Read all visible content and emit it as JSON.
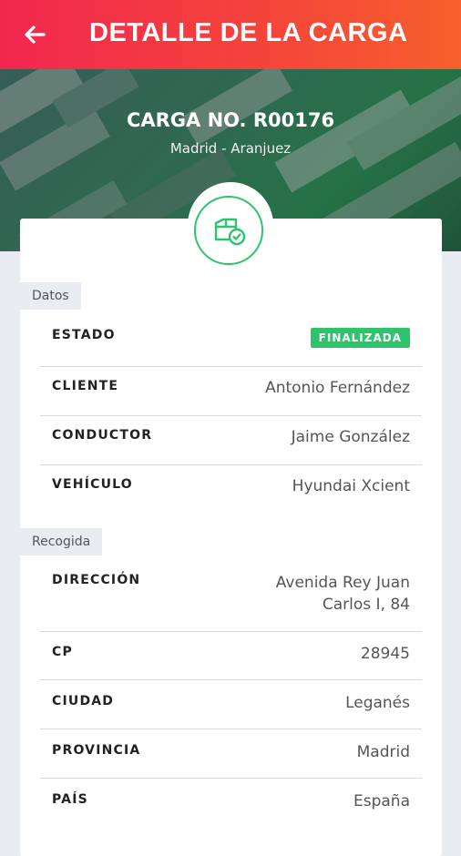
{
  "appbar": {
    "title": "DETALLE DE LA CARGA",
    "back_icon": "arrow-left-icon",
    "gradient": [
      "#f2274f",
      "#f75f2c"
    ]
  },
  "hero": {
    "title": "CARGA NO. R00176",
    "subtitle": "Madrid - Aranjuez"
  },
  "badge": {
    "icon": "package-check-icon",
    "color": "#2ec46b"
  },
  "datos": {
    "section_label": "Datos",
    "estado_label": "ESTADO",
    "estado_value": "FINALIZADA",
    "cliente_label": "CLIENTE",
    "cliente_value": "Antonio Fernández",
    "conductor_label": "CONDUCTOR",
    "conductor_value": "Jaime González",
    "vehiculo_label": "VEHÍCULO",
    "vehiculo_value": "Hyundai Xcient"
  },
  "recogida": {
    "section_label": "Recogida",
    "direccion_label": "DIRECCIÓN",
    "direccion_line1": "Avenida Rey Juan",
    "direccion_line2": "Carlos I, 84",
    "cp_label": "CP",
    "cp_value": "28945",
    "ciudad_label": "CIUDAD",
    "ciudad_value": "Leganés",
    "provincia_label": "PROVINCIA",
    "provincia_value": "Madrid",
    "pais_label": "PAÍS",
    "pais_value": "España"
  }
}
